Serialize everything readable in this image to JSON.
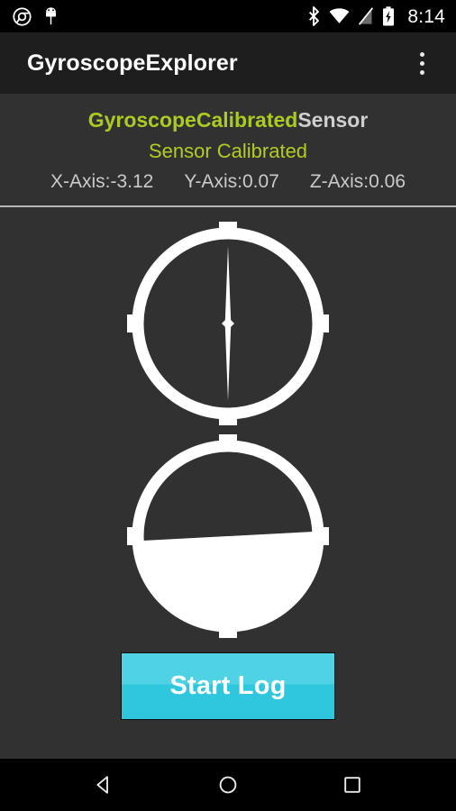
{
  "status_bar": {
    "icons_left": [
      "chrome-icon",
      "android-robot-icon"
    ],
    "icons_right": [
      "bluetooth-icon",
      "wifi-icon",
      "signal-off-icon",
      "battery-charging-icon"
    ],
    "time": "8:14"
  },
  "app_bar": {
    "title": "GyroscopeExplorer",
    "overflow_menu": "overflow-menu-icon"
  },
  "sensor_info": {
    "sensor_name_highlight": "GyroscopeCalibrated",
    "sensor_name_suffix": "Sensor",
    "status": "Sensor Calibrated",
    "axes": [
      {
        "label": "X-Axis:",
        "value": "-3.12",
        "text": "X-Axis:-3.12"
      },
      {
        "label": "Y-Axis:",
        "value": "0.07",
        "text": "Y-Axis:0.07"
      },
      {
        "label": "Z-Axis:",
        "value": "0.06",
        "text": "Z-Axis:0.06"
      }
    ]
  },
  "gauges": {
    "compass": {
      "name": "gyroscope-compass-gauge",
      "needle_angle_deg": 0,
      "tick_positions_deg": [
        0,
        90,
        180,
        270
      ]
    },
    "horizon": {
      "name": "artificial-horizon-gauge",
      "roll_angle_deg": -3.0,
      "pitch_offset": 0.0,
      "tick_positions_deg": [
        0,
        90,
        180,
        270
      ]
    }
  },
  "actions": {
    "start_log_label": "Start Log"
  },
  "nav_bar": {
    "back": "back-icon",
    "home": "home-icon",
    "recents": "recents-icon"
  },
  "colors": {
    "accent_green": "#aacc22",
    "button_cyan": "#4ed2e4",
    "background": "#313131",
    "appbar": "#1e1e1e",
    "gauge_white": "#ffffff"
  }
}
